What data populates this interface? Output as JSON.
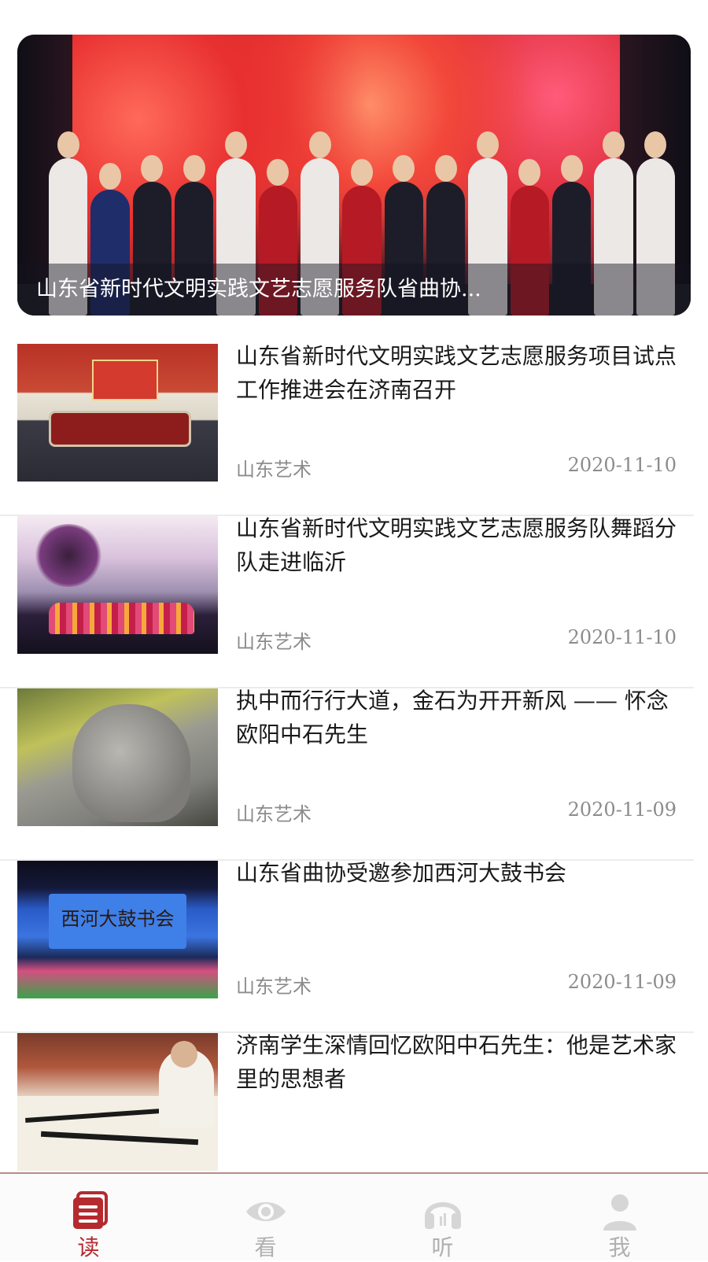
{
  "banner": {
    "caption": "山东省新时代文明实践文艺志愿服务队省曲协..."
  },
  "articles": [
    {
      "title": "山东省新时代文明实践文艺志愿服务项目试点工作推进会在济南召开",
      "source": "山东艺术",
      "date": "2020-11-10"
    },
    {
      "title": "山东省新时代文明实践文艺志愿服务队舞蹈分队走进临沂",
      "source": "山东艺术",
      "date": "2020-11-10"
    },
    {
      "title": "执中而行行大道，金石为开开新风 —— 怀念欧阳中石先生",
      "source": "山东艺术",
      "date": "2020-11-09"
    },
    {
      "title": "山东省曲协受邀参加西河大鼓书会",
      "source": "山东艺术",
      "date": "2020-11-09",
      "thumb_text": "西河大鼓书会"
    },
    {
      "title": "济南学生深情回忆欧阳中石先生：他是艺术家里的思想者",
      "source": "",
      "date": ""
    }
  ],
  "tabbar": {
    "tabs": [
      {
        "label": "读",
        "icon": "book-icon",
        "active": true
      },
      {
        "label": "看",
        "icon": "eye-icon",
        "active": false
      },
      {
        "label": "听",
        "icon": "headphones-icon",
        "active": false
      },
      {
        "label": "我",
        "icon": "person-icon",
        "active": false
      }
    ]
  },
  "colors": {
    "accent": "#b52a2f",
    "inactive": "#b0b0b0",
    "meta_text": "#8c8c8c",
    "separator": "#ececec"
  }
}
